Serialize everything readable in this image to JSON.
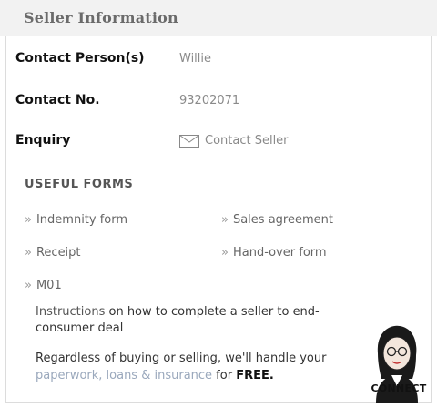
{
  "header": {
    "title": "Seller Information"
  },
  "seller": {
    "contact_label": "Contact Person(s)",
    "contact_value": "Willie",
    "phone_label": "Contact No.",
    "phone_value": "93202071",
    "enquiry_label": "Enquiry",
    "enquiry_link": "Contact Seller",
    "enquiry_icon": "envelope-icon"
  },
  "useful_forms": {
    "title": "USEFUL FORMS",
    "bullet": "»",
    "items": [
      "Indemnity form",
      "Sales agreement",
      "Receipt",
      "Hand-over form",
      "M01"
    ]
  },
  "instructions": {
    "link": "Instructions",
    "text": " on how to complete a seller to end-consumer deal"
  },
  "handle": {
    "text_a": "Regardless of buying or selling, we'll handle your ",
    "highlight": "paperwork, loans & insurance",
    "text_b": " for ",
    "free": "FREE."
  },
  "brand": {
    "name": "CONNECT"
  },
  "colors": {
    "header_bg": "#f2f2f2",
    "muted_text": "#8a8a8a",
    "highlight": "#9aa8bc"
  }
}
